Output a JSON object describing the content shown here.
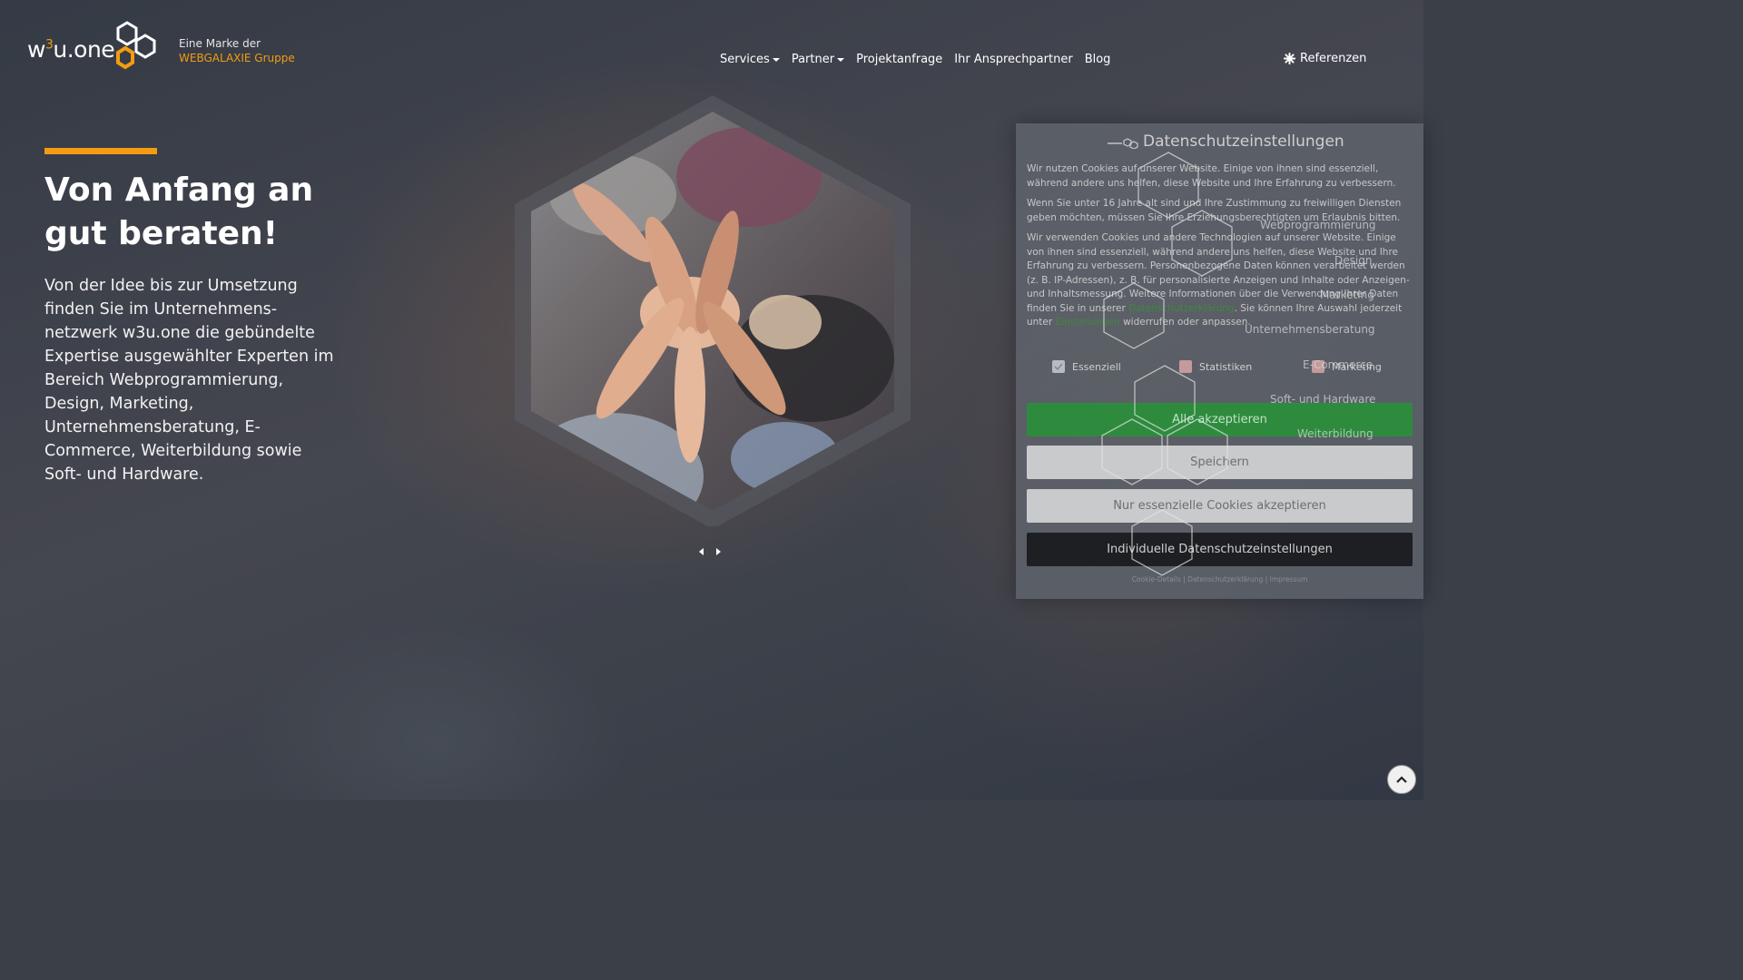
{
  "brand": {
    "logo_text_a": "w",
    "logo_text_sup": "3",
    "logo_text_b": "u.one",
    "tag_line1": "Eine Marke der",
    "tag_line2": "WEBGALAXIE Gruppe"
  },
  "nav": {
    "items": [
      {
        "label": "Services",
        "dropdown": true
      },
      {
        "label": "Partner",
        "dropdown": true
      },
      {
        "label": "Projektanfrage",
        "dropdown": false
      },
      {
        "label": "Ihr Ansprechpartner",
        "dropdown": false
      },
      {
        "label": "Blog",
        "dropdown": false
      }
    ],
    "referenzen": "Referenzen"
  },
  "hero": {
    "title": "Von Anfang an gut beraten!",
    "text": "Von der Idee bis zur Umsetzung finden Sie im Unternehmens-netzwerk w3u.one die gebündelte Expertise ausgewählter Experten im Bereich Webprogrammierung, Design, Marketing, Unternehmensberatung, E-Commerce, Weiterbildung sowie Soft- und Hardware."
  },
  "services_overlay": [
    "Webprogrammierung",
    "Design",
    "Marketing",
    "Unternehmensberatung",
    "E-Commerce",
    "Soft- und Hardware",
    "Weiterbildung"
  ],
  "cookie": {
    "title": "Datenschutzeinstellungen",
    "p1": "Wir nutzen Cookies auf unserer Website. Einige von ihnen sind essenziell, während andere uns helfen, diese Website und Ihre Erfahrung zu verbessern.",
    "p2": "Wenn Sie unter 16 Jahre alt sind und Ihre Zustimmung zu freiwilligen Diensten geben möchten, müssen Sie Ihre Erziehungsberechtigten um Erlaubnis bitten.",
    "p3_a": "Wir verwenden Cookies und andere Technologien auf unserer Website. Einige von ihnen sind essenziell, während andere uns helfen, diese Website und Ihre Erfahrung zu verbessern. Personenbezogene Daten können verarbeitet werden (z. B. IP-Adressen), z. B. für personalisierte Anzeigen und Inhalte oder Anzeigen- und Inhaltsmessung. Weitere Informationen über die Verwendung Ihrer Daten finden Sie in unserer ",
    "p3_link1": "Datenschutzerklärung",
    "p3_b": ". Sie können Ihre Auswahl jederzeit unter ",
    "p3_link2": "Einstellungen",
    "p3_c": " widerrufen oder anpassen.",
    "checks": [
      {
        "label": "Essenziell",
        "checked": true,
        "color": "#b8bcc2"
      },
      {
        "label": "Statistiken",
        "checked": false,
        "color": "#c59a9c"
      },
      {
        "label": "Marketing",
        "checked": false,
        "color": "#c59a9c"
      }
    ],
    "btn_accept": "Alle akzeptieren",
    "btn_save": "Speichern",
    "btn_essential": "Nur essenzielle Cookies akzeptieren",
    "btn_individual": "Individuelle Datenschutzeinstellungen",
    "footer_links": [
      "Cookie-Details",
      "Datenschutzerklärung",
      "Impressum"
    ],
    "footer_sep": " | "
  },
  "colors": {
    "accent": "#f39c12",
    "accept_green": "#2e8b3e",
    "dark_button": "#1d1f23"
  },
  "icons": {
    "referenzen_icon": "gear-icon",
    "scroll_top": "chevron-up-icon"
  }
}
